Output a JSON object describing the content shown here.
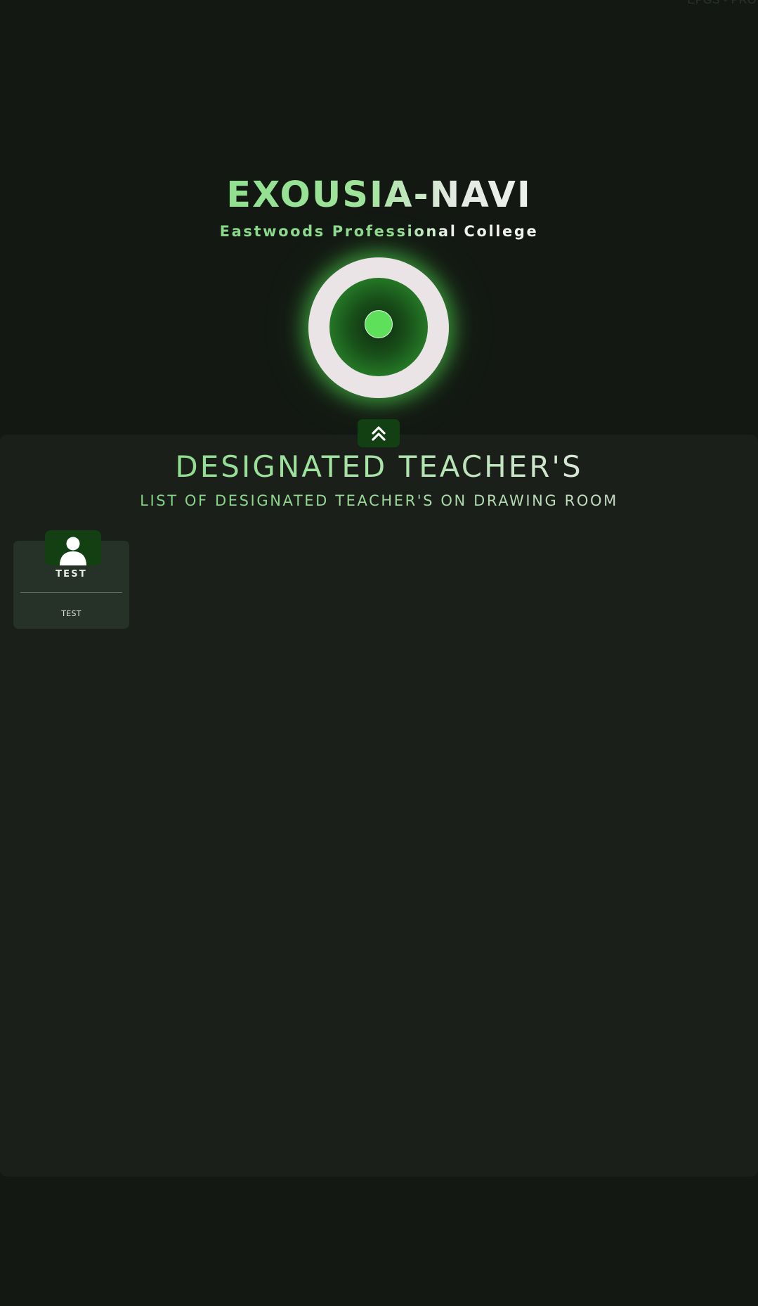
{
  "header": {
    "corner_text": "EPGS - PRO",
    "title": "EXOUSIA-NAVI",
    "subtitle": "Eastwoods Professional College"
  },
  "logo": {
    "icon": "target-icon"
  },
  "scroll_button": {
    "icon": "double-chevron-up-icon"
  },
  "section": {
    "title": "DESIGNATED TEACHER'S",
    "subtitle": "LIST OF DESIGNATED TEACHER'S ON DRAWING ROOM"
  },
  "teachers": [
    {
      "name": "TEST",
      "role": "TEST",
      "avatar_icon": "user-icon"
    }
  ],
  "colors": {
    "background": "#131813",
    "panel": "#1b1f1a",
    "card": "#263227",
    "accent_dark_green": "#134012",
    "accent_light_green": "#8fe08f",
    "logo_dot": "#5ee05a",
    "logo_ring": "#ebe4e6"
  }
}
